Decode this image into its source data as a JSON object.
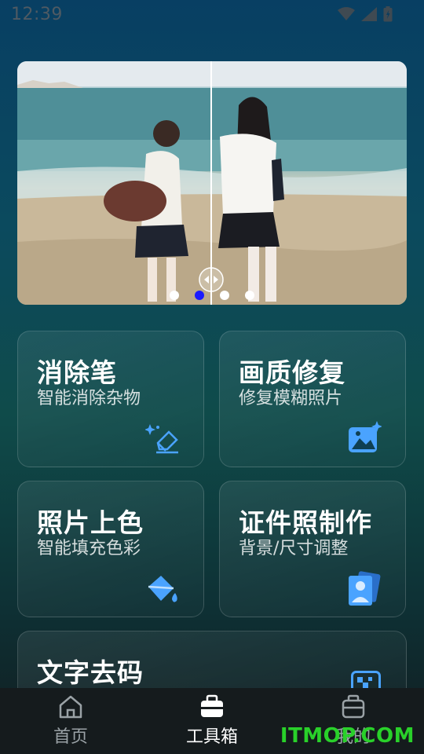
{
  "status_bar": {
    "time": "12:39"
  },
  "banner": {
    "dots": [
      {
        "active": false
      },
      {
        "active": true
      },
      {
        "active": false
      },
      {
        "active": false
      }
    ]
  },
  "tools": [
    {
      "title": "消除笔",
      "desc": "智能消除杂物",
      "icon": "eraser-icon"
    },
    {
      "title": "画质修复",
      "desc": "修复模糊照片",
      "icon": "photo-enhance-icon"
    },
    {
      "title": "照片上色",
      "desc": "智能填充色彩",
      "icon": "paint-bucket-icon"
    },
    {
      "title": "证件照制作",
      "desc": "背景/尺寸调整",
      "icon": "id-photo-icon"
    },
    {
      "title": "文字去码",
      "desc": "",
      "icon": "mosaic-icon"
    }
  ],
  "tabbar": {
    "items": [
      {
        "label": "首页",
        "icon": "home-icon",
        "active": false
      },
      {
        "label": "工具箱",
        "icon": "toolbox-icon",
        "active": true
      },
      {
        "label": "我的",
        "icon": "profile-icon",
        "active": false
      }
    ]
  },
  "watermark": "ITMOP.COM",
  "colors": {
    "accent_dot": "#1a1aff",
    "icon_blue": "#4aa3ff",
    "watermark": "#29d12a"
  }
}
